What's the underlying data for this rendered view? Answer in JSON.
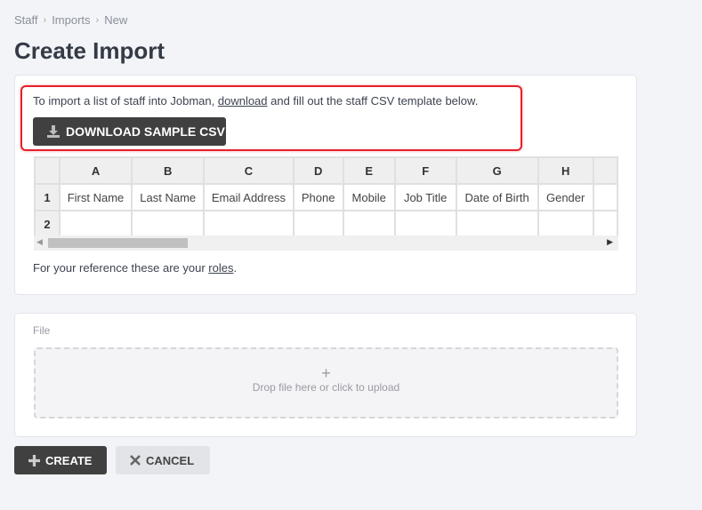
{
  "breadcrumb": [
    "Staff",
    "Imports",
    "New"
  ],
  "title": "Create Import",
  "intro": {
    "before": "To import a list of staff into Jobman, ",
    "link": "download",
    "after": " and fill out the staff CSV template below."
  },
  "download_button": "DOWNLOAD SAMPLE CSV",
  "sheet": {
    "columns": [
      "A",
      "B",
      "C",
      "D",
      "E",
      "F",
      "G",
      "H"
    ],
    "rows": [
      {
        "num": "1",
        "cells": [
          "First Name",
          "Last Name",
          "Email Address",
          "Phone",
          "Mobile",
          "Job Title",
          "Date of Birth",
          "Gender"
        ]
      },
      {
        "num": "2",
        "cells": [
          "",
          "",
          "",
          "",
          "",
          "",
          "",
          ""
        ]
      }
    ]
  },
  "reference": {
    "before": "For your reference these are your ",
    "link": "roles",
    "after": "."
  },
  "file": {
    "label": "File",
    "plus": "+",
    "drop_text": "Drop file here or click to upload"
  },
  "actions": {
    "create": "CREATE",
    "cancel": "CANCEL"
  }
}
